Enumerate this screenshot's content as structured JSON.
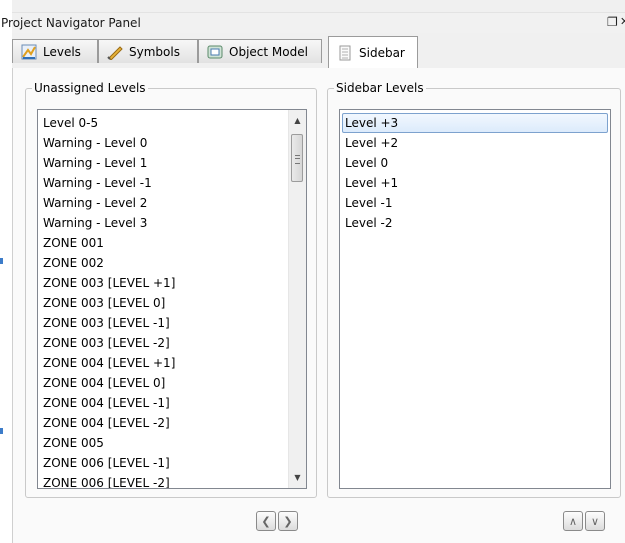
{
  "panel": {
    "title": "Project Navigator Panel",
    "float_icon": "float-window-icon",
    "float_glyph": "❐",
    "close_glyph": "✕"
  },
  "tabs": [
    {
      "label": "Levels",
      "icon": "levels-icon",
      "active": false
    },
    {
      "label": "Symbols",
      "icon": "symbols-icon",
      "active": false
    },
    {
      "label": "Object Model",
      "icon": "object-model-icon",
      "active": false
    },
    {
      "label": "Sidebar",
      "icon": "sidebar-icon",
      "active": true
    }
  ],
  "unassigned": {
    "label": "Unassigned Levels",
    "items": [
      "Level 0-5",
      "Warning - Level 0",
      "Warning - Level 1",
      "Warning - Level -1",
      "Warning - Level 2",
      "Warning - Level 3",
      "ZONE 001",
      "ZONE 002",
      "ZONE 003 [LEVEL +1]",
      "ZONE 003 [LEVEL 0]",
      "ZONE 003 [LEVEL -1]",
      "ZONE 003 [LEVEL -2]",
      "ZONE 004 [LEVEL +1]",
      "ZONE 004 [LEVEL 0]",
      "ZONE 004 [LEVEL -1]",
      "ZONE 004 [LEVEL -2]",
      "ZONE 005",
      "ZONE 006 [LEVEL -1]",
      "ZONE 006 [LEVEL -2]"
    ]
  },
  "sidebar_levels": {
    "label": "Sidebar Levels",
    "items": [
      "Level +3",
      "Level +2",
      "Level 0",
      "Level +1",
      "Level -1",
      "Level -2"
    ],
    "selected_index": 0
  },
  "scrollbar": {
    "up_glyph": "▲",
    "down_glyph": "▼"
  },
  "buttons": {
    "move_left": "❮",
    "move_right": "❯",
    "move_up": "∧",
    "move_down": "∨"
  },
  "colors": {
    "selection_border": "#7da2ce",
    "selection_fill": "#dcebfc",
    "accent_mark": "#3d7cc9"
  }
}
